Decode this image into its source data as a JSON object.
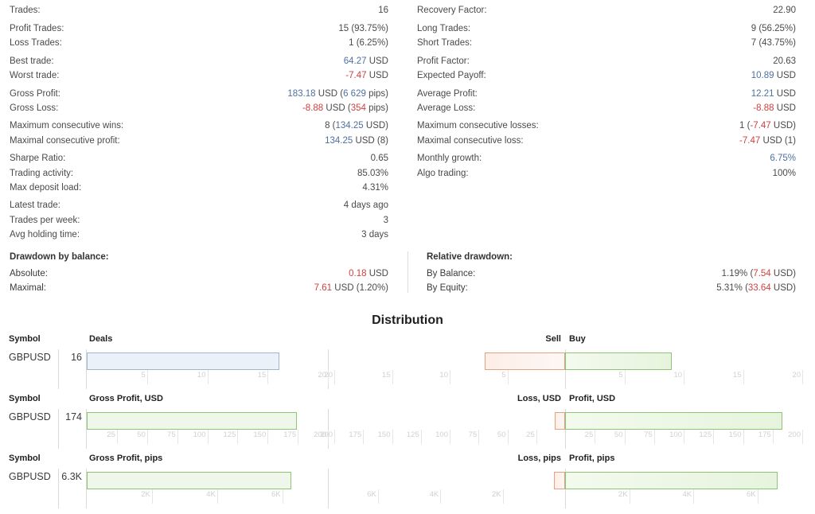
{
  "stats": {
    "left": [
      {
        "label": "Trades:",
        "value": "16",
        "tone": "dim"
      },
      {
        "spacer": true
      },
      {
        "label": "Profit Trades:",
        "value": "15 (93.75%)",
        "tone": "dim"
      },
      {
        "label": "Loss Trades:",
        "value": "1 (6.25%)",
        "tone": "dim"
      },
      {
        "spacer": true
      },
      {
        "label": "Best trade:",
        "parts": [
          {
            "t": "64.27",
            "tone": "blue"
          },
          {
            "t": " USD",
            "tone": "dim"
          }
        ]
      },
      {
        "label": "Worst trade:",
        "parts": [
          {
            "t": "-7.47",
            "tone": "red"
          },
          {
            "t": " USD",
            "tone": "dim"
          }
        ]
      },
      {
        "spacer": true
      },
      {
        "label": "Gross Profit:",
        "parts": [
          {
            "t": "183.18",
            "tone": "blue"
          },
          {
            "t": " USD (",
            "tone": "dim"
          },
          {
            "t": "6 629",
            "tone": "blue"
          },
          {
            "t": " pips)",
            "tone": "dim"
          }
        ]
      },
      {
        "label": "Gross Loss:",
        "parts": [
          {
            "t": "-8.88",
            "tone": "red"
          },
          {
            "t": " USD (",
            "tone": "dim"
          },
          {
            "t": "354",
            "tone": "red"
          },
          {
            "t": " pips)",
            "tone": "dim"
          }
        ]
      },
      {
        "spacer": true
      },
      {
        "label": "Maximum consecutive wins:",
        "parts": [
          {
            "t": "8 (",
            "tone": "dim"
          },
          {
            "t": "134.25",
            "tone": "blue"
          },
          {
            "t": " USD)",
            "tone": "dim"
          }
        ]
      },
      {
        "label": "Maximal consecutive profit:",
        "parts": [
          {
            "t": "134.25",
            "tone": "blue"
          },
          {
            "t": " USD (8)",
            "tone": "dim"
          }
        ]
      },
      {
        "spacer": true
      },
      {
        "label": "Sharpe Ratio:",
        "value": "0.65",
        "tone": "dim"
      },
      {
        "label": "Trading activity:",
        "value": "85.03%",
        "tone": "dim"
      },
      {
        "label": "Max deposit load:",
        "value": "4.31%",
        "tone": "dim"
      },
      {
        "spacer": true
      },
      {
        "label": "Latest trade:",
        "value": "4 days ago",
        "tone": "dim"
      },
      {
        "label": "Trades per week:",
        "value": "3",
        "tone": "dim"
      },
      {
        "label": "Avg holding time:",
        "value": "3 days",
        "tone": "dim"
      }
    ],
    "right": [
      {
        "label": "Recovery Factor:",
        "value": "22.90",
        "tone": "dim"
      },
      {
        "spacer": true
      },
      {
        "label": "Long Trades:",
        "value": "9 (56.25%)",
        "tone": "dim"
      },
      {
        "label": "Short Trades:",
        "value": "7 (43.75%)",
        "tone": "dim"
      },
      {
        "spacer": true
      },
      {
        "label": "Profit Factor:",
        "value": "20.63",
        "tone": "dim"
      },
      {
        "label": "Expected Payoff:",
        "parts": [
          {
            "t": "10.89",
            "tone": "blue"
          },
          {
            "t": " USD",
            "tone": "dim"
          }
        ]
      },
      {
        "spacer": true
      },
      {
        "label": "Average Profit:",
        "parts": [
          {
            "t": "12.21",
            "tone": "blue"
          },
          {
            "t": " USD",
            "tone": "dim"
          }
        ]
      },
      {
        "label": "Average Loss:",
        "parts": [
          {
            "t": "-8.88",
            "tone": "red"
          },
          {
            "t": " USD",
            "tone": "dim"
          }
        ]
      },
      {
        "spacer": true
      },
      {
        "label": "Maximum consecutive losses:",
        "parts": [
          {
            "t": "1 (",
            "tone": "dim"
          },
          {
            "t": "-7.47",
            "tone": "red"
          },
          {
            "t": " USD)",
            "tone": "dim"
          }
        ]
      },
      {
        "label": "Maximal consecutive loss:",
        "parts": [
          {
            "t": "-7.47",
            "tone": "red"
          },
          {
            "t": " USD (1)",
            "tone": "dim"
          }
        ]
      },
      {
        "spacer": true
      },
      {
        "label": "Monthly growth:",
        "parts": [
          {
            "t": "6.75%",
            "tone": "blue"
          }
        ]
      },
      {
        "label": "Algo trading:",
        "value": "100%",
        "tone": "dim"
      }
    ]
  },
  "drawdown": {
    "left_title": "Drawdown by balance:",
    "right_title": "Relative drawdown:",
    "left_rows": [
      {
        "label": "Absolute:",
        "parts": [
          {
            "t": "0.18",
            "tone": "red"
          },
          {
            "t": " USD",
            "tone": "dim"
          }
        ]
      },
      {
        "label": "Maximal:",
        "parts": [
          {
            "t": "7.61",
            "tone": "red"
          },
          {
            "t": " USD (1.20%)",
            "tone": "dim"
          }
        ]
      }
    ],
    "right_rows": [
      {
        "label": "By Balance:",
        "parts": [
          {
            "t": "1.19% (",
            "tone": "dim"
          },
          {
            "t": "7.54",
            "tone": "red"
          },
          {
            "t": " USD)",
            "tone": "dim"
          }
        ]
      },
      {
        "label": "By Equity:",
        "parts": [
          {
            "t": "5.31% (",
            "tone": "dim"
          },
          {
            "t": "33.64",
            "tone": "red"
          },
          {
            "t": " USD)",
            "tone": "dim"
          }
        ]
      }
    ]
  },
  "distribution": {
    "title": "Distribution",
    "symbol_header": "Symbol",
    "symbol_name": "GBPUSD"
  },
  "chart_data": [
    {
      "type": "bar",
      "title": "Deals",
      "left_label": "Deals",
      "right_labels": [
        "Sell",
        "Buy"
      ],
      "categories": [
        "GBPUSD"
      ],
      "row_value_label": "16",
      "left_series": {
        "name": "Deals",
        "values": [
          16
        ],
        "color": "#eaf1f8",
        "border": "#9fb6cd"
      },
      "right_series": [
        {
          "name": "Sell",
          "values": [
            7
          ],
          "color": "#fdeee6",
          "border": "#e5a184",
          "direction": "left"
        },
        {
          "name": "Buy",
          "values": [
            9
          ],
          "color": "#eef7e9",
          "border": "#8fc472",
          "direction": "right"
        }
      ],
      "left_axis": {
        "ticks": [
          5,
          10,
          15,
          20
        ],
        "labels": [
          "5",
          "10",
          "15",
          "20"
        ],
        "max": 20
      },
      "right_axis": {
        "left_ticks": [
          20,
          15,
          10,
          5
        ],
        "left_labels": [
          "20",
          "15",
          "10",
          "5"
        ],
        "right_ticks": [
          5,
          10,
          15,
          20
        ],
        "right_labels": [
          "5",
          "10",
          "15",
          "20"
        ],
        "max": 20
      }
    },
    {
      "type": "bar",
      "title": "Gross Profit, USD",
      "left_label": "Gross Profit, USD",
      "right_labels": [
        "Loss, USD",
        "Profit, USD"
      ],
      "categories": [
        "GBPUSD"
      ],
      "row_value_label": "174",
      "left_series": {
        "name": "Gross Profit, USD",
        "values": [
          174
        ],
        "color": "#eef7e9",
        "border": "#8fc472"
      },
      "right_series": [
        {
          "name": "Loss, USD",
          "values": [
            9
          ],
          "color": "#fdeee6",
          "border": "#e5a184",
          "direction": "left"
        },
        {
          "name": "Profit, USD",
          "values": [
            183
          ],
          "color": "#eef7e9",
          "border": "#8fc472",
          "direction": "right"
        }
      ],
      "left_axis": {
        "ticks": [
          25,
          50,
          75,
          100,
          125,
          150,
          175,
          200
        ],
        "labels": [
          "25",
          "50",
          "75",
          "100",
          "125",
          "150",
          "175",
          "200"
        ],
        "max": 200
      },
      "right_axis": {
        "left_ticks": [
          200,
          175,
          150,
          125,
          100,
          75,
          50,
          25
        ],
        "left_labels": [
          "200",
          "175",
          "150",
          "125",
          "100",
          "75",
          "50",
          "25"
        ],
        "right_ticks": [
          25,
          50,
          75,
          100,
          125,
          150,
          175,
          200
        ],
        "right_labels": [
          "25",
          "50",
          "75",
          "100",
          "125",
          "150",
          "175",
          "200"
        ],
        "max": 200
      }
    },
    {
      "type": "bar",
      "title": "Gross Profit, pips",
      "left_label": "Gross Profit, pips",
      "right_labels": [
        "Loss, pips",
        "Profit, pips"
      ],
      "categories": [
        "GBPUSD"
      ],
      "row_value_label": "6.3K",
      "left_series": {
        "name": "Gross Profit, pips",
        "values": [
          6275
        ],
        "color": "#eef7e9",
        "border": "#8fc472"
      },
      "right_series": [
        {
          "name": "Loss, pips",
          "values": [
            354
          ],
          "color": "#fdeee6",
          "border": "#e5a184",
          "direction": "left"
        },
        {
          "name": "Profit, pips",
          "values": [
            6629
          ],
          "color": "#eef7e9",
          "border": "#8fc472",
          "direction": "right"
        }
      ],
      "left_axis": {
        "ticks": [
          2000,
          4000,
          6000
        ],
        "labels": [
          "2K",
          "4K",
          "6K"
        ],
        "max": 7400
      },
      "right_axis": {
        "left_ticks": [
          6000,
          4000,
          2000
        ],
        "left_labels": [
          "6K",
          "4K",
          "2K"
        ],
        "right_ticks": [
          2000,
          4000,
          6000
        ],
        "right_labels": [
          "2K",
          "4K",
          "6K"
        ],
        "max": 7400
      }
    }
  ]
}
